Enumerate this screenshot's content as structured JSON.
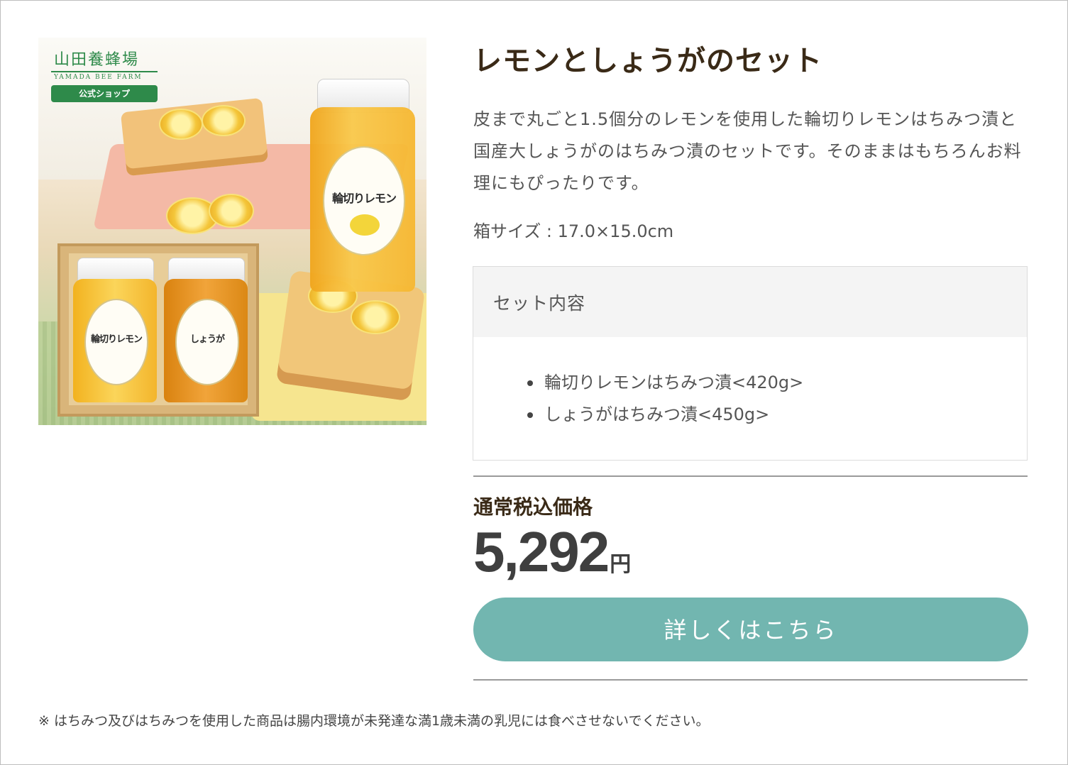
{
  "product": {
    "title": "レモンとしょうがのセット",
    "description": "皮まで丸ごと1.5個分のレモンを使用した輪切りレモンはちみつ漬と国産大しょうがのはちみつ漬のセットです。そのままはもちろんお料理にもぴったりです。",
    "box_size": "箱サイズ : 17.0×15.0cm"
  },
  "image": {
    "brand_name": "山田養蜂場",
    "brand_en": "YAMADA BEE FARM",
    "shop_badge": "公式ショップ",
    "jar_lemon_label": "輪切りレモン",
    "jar_ginger_label": "しょうが"
  },
  "set_contents": {
    "title": "セット内容",
    "items": [
      "輪切りレモンはちみつ漬<420g>",
      "しょうがはちみつ漬<450g>"
    ]
  },
  "price": {
    "label": "通常税込価格",
    "value": "5,292",
    "unit": "円"
  },
  "cta": {
    "label": "詳しくはこちら"
  },
  "footnote": "※ はちみつ及びはちみつを使用した商品は腸内環境が未発達な満1歳未満の乳児には食べさせないでください。",
  "colors": {
    "button": "#72b6b0",
    "title": "#3a2a17",
    "brand_green": "#2e8a4a"
  }
}
